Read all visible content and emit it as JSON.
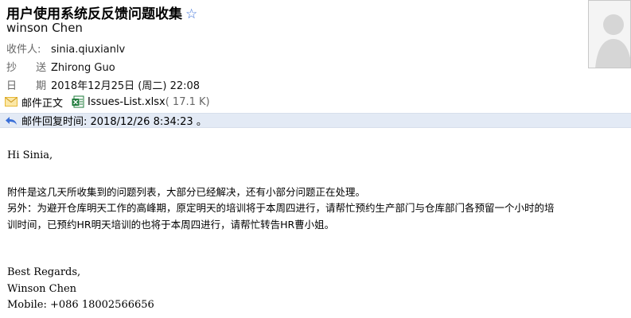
{
  "email": {
    "subject": "用户使用系统反反馈问题收集",
    "star_icon": "star-icon",
    "sender_name": "winson Chen",
    "to_label": "收件人:",
    "to_value": "sinia.qiuxianlv",
    "cc_label": "抄 送:",
    "cc_value": "Zhirong Guo",
    "date_label": "日 期:",
    "date_value": "2018年12月25日 (周二) 22:08",
    "attachment_section_label": "邮件正文",
    "attachment_name": "Issues-List.xlsx",
    "attachment_size": "( 17.1 K)",
    "reply_notice": "邮件回复时间: 2018/12/26 8:34:23 。"
  },
  "body": {
    "greeting": "Hi Sinia,",
    "para1": "附件是这几天所收集到的问题列表，大部分已经解决，还有小部分问题正在处理。",
    "para2_line1": "另外：为避开仓库明天工作的高峰期，原定明天的培训将于本周四进行，请帮忙预约生产部门与仓库部门各预留一个小时的培",
    "para2_line2": "训时间，已预约HR明天培训的也将于本周四进行，请帮忙转告HR曹小姐。",
    "closing": "Best Regards,",
    "signature_name": "Winson Chen",
    "signature_mobile": "Mobile: +086 18002566656"
  },
  "colors": {
    "reply_bar": "#e3eaf5",
    "star": "#3a6fd8",
    "excel_green": "#1e7b3a",
    "envelope_yellow": "#e8b935"
  }
}
